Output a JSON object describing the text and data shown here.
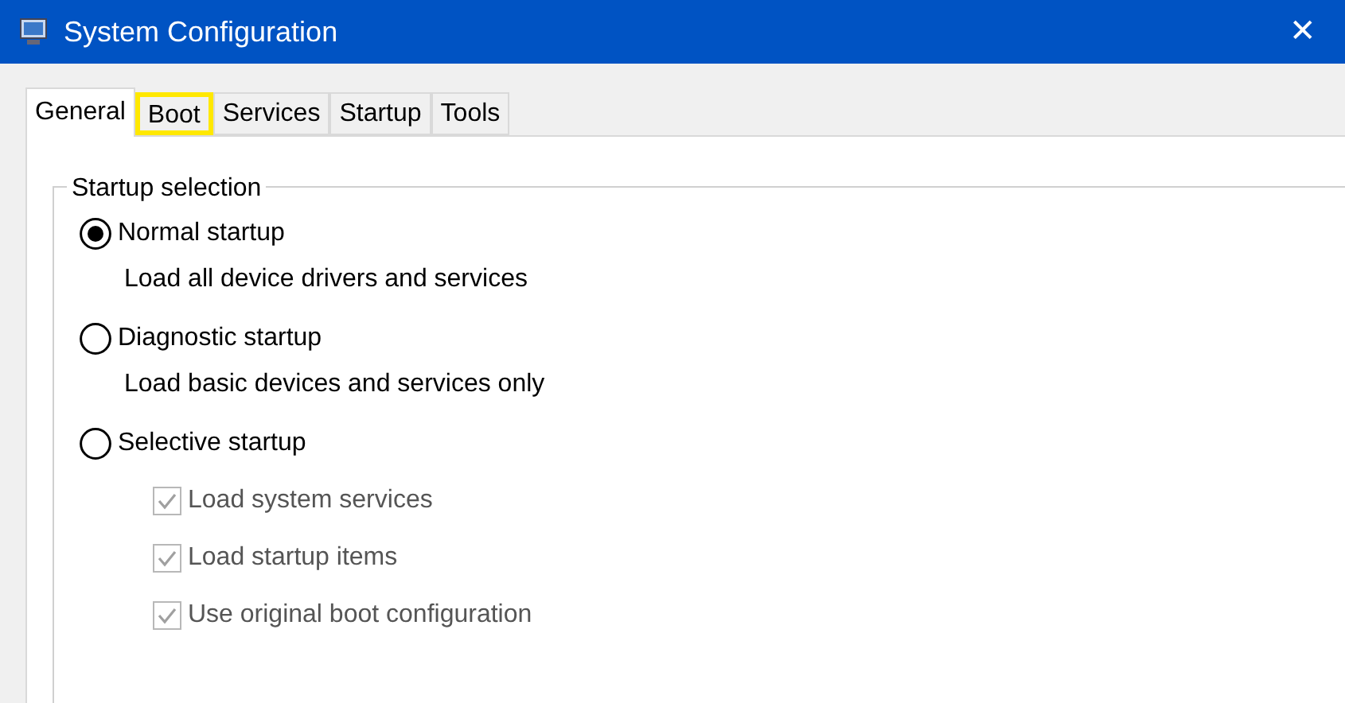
{
  "window": {
    "title": "System Configuration",
    "close": "✕"
  },
  "tabs": [
    {
      "label": "General",
      "selected": true,
      "highlighted": false
    },
    {
      "label": "Boot",
      "selected": false,
      "highlighted": true
    },
    {
      "label": "Services",
      "selected": false,
      "highlighted": false
    },
    {
      "label": "Startup",
      "selected": false,
      "highlighted": false
    },
    {
      "label": "Tools",
      "selected": false,
      "highlighted": false
    }
  ],
  "group": {
    "title": "Startup selection",
    "options": [
      {
        "label": "Normal startup",
        "selected": true,
        "description": "Load all device drivers and services"
      },
      {
        "label": "Diagnostic startup",
        "selected": false,
        "description": "Load basic devices and services only"
      },
      {
        "label": "Selective startup",
        "selected": false
      }
    ],
    "checkboxes": [
      {
        "label": "Load system services",
        "checked": true,
        "disabled": true
      },
      {
        "label": "Load startup items",
        "checked": true,
        "disabled": true
      },
      {
        "label": "Use original boot configuration",
        "checked": true,
        "disabled": true
      }
    ]
  }
}
